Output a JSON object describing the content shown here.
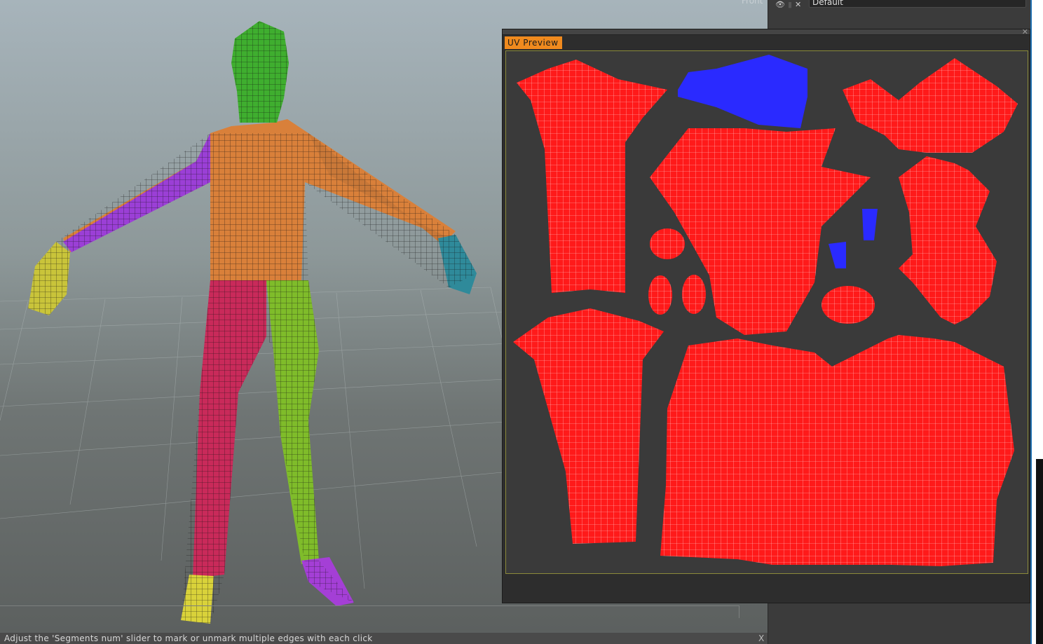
{
  "viewport": {
    "label": "Front"
  },
  "layers": {
    "layer_name": "Default",
    "icons": [
      "eye-icon",
      "lock-icon",
      "close-icon"
    ]
  },
  "uv_preview": {
    "tab_label": "UV Preview",
    "close_label": "✕"
  },
  "status_bar": {
    "message": "Adjust the 'Segments num' slider to mark or unmark multiple edges with each click",
    "close_label": "X"
  },
  "colors": {
    "uv_island": "#ff1a1a",
    "uv_selected": "#1a1aff",
    "tab": "#f08a1e",
    "seam": "#7cff3a"
  }
}
